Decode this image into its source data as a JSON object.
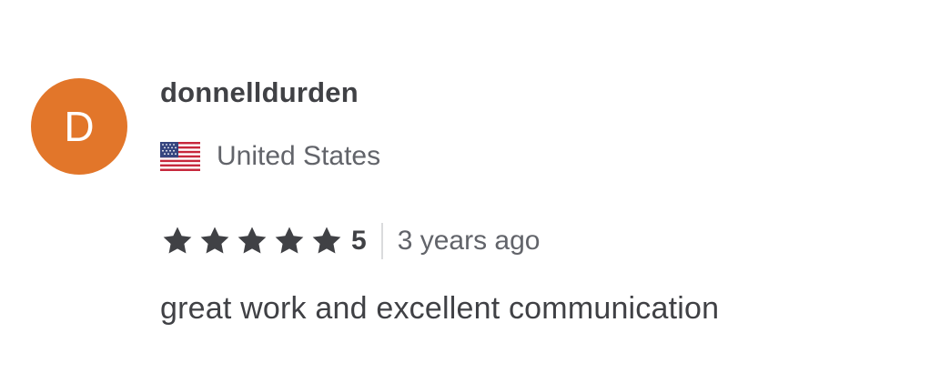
{
  "review": {
    "avatar_initial": "D",
    "username": "donnelldurden",
    "country": "United States",
    "country_flag_icon": "us-flag-icon",
    "rating": "5",
    "star_count": 5,
    "time_ago": "3 years ago",
    "text": "great work and excellent communication"
  },
  "colors": {
    "avatar_background": "#e2762a",
    "star": "#404145",
    "primary_text": "#404145",
    "secondary_text": "#62646a",
    "divider": "#dadbdd"
  }
}
